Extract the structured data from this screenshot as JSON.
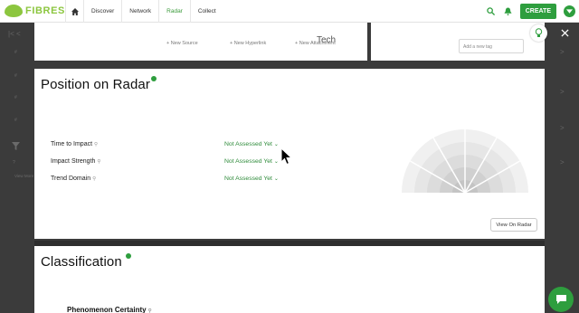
{
  "brand": {
    "name": "FIBRES",
    "color": "#8cc63f"
  },
  "nav": {
    "home_icon": "home-icon",
    "crumbs": [
      "Discover",
      "Network",
      "Radar",
      "Collect"
    ],
    "active": "Radar",
    "create_label": "CREATE",
    "accent": "#2e9e3e"
  },
  "background": {
    "sidebar_items": [
      "#",
      "#",
      "#",
      "#"
    ],
    "side_label": "View More"
  },
  "top_panel": {
    "buttons": [
      "+ New Source",
      "+ New Hyperlink",
      "+ New Attachment"
    ],
    "tab_label": "Tech",
    "tag_placeholder": "Add a new tag"
  },
  "position_on_radar": {
    "title": "Position on Radar",
    "rows": [
      {
        "label": "Time to Impact",
        "value": "Not Assessed Yet"
      },
      {
        "label": "Impact Strength",
        "value": "Not Assessed Yet"
      },
      {
        "label": "Trend Domain",
        "value": "Not Assessed Yet"
      }
    ],
    "view_button": "View On Radar"
  },
  "classification": {
    "title": "Classification",
    "first_field": "Phenomenon Certainty"
  }
}
